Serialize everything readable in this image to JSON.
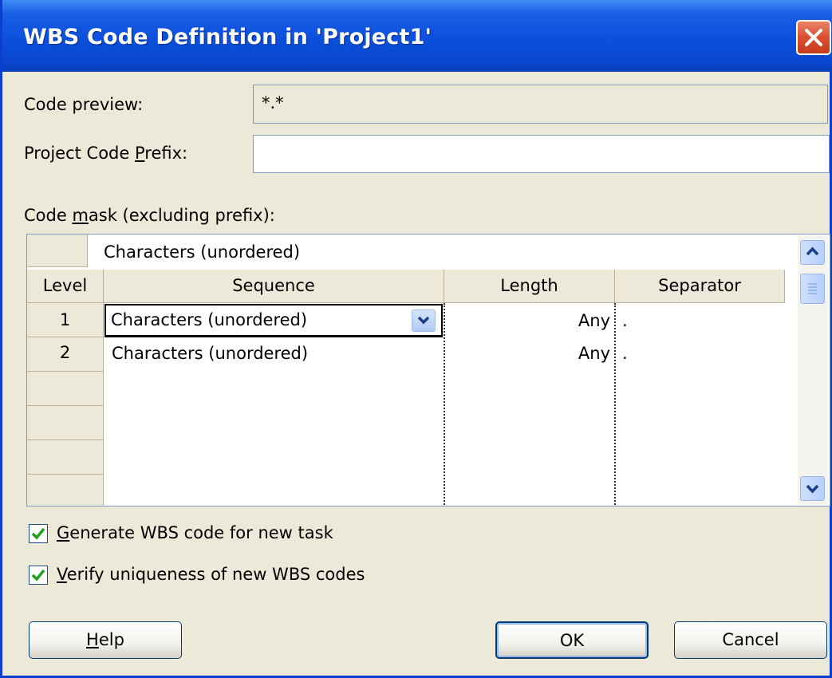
{
  "window": {
    "title": "WBS Code Definition in 'Project1'"
  },
  "code_preview": {
    "label": "Code preview:",
    "value": "*.*"
  },
  "project_prefix": {
    "label_pre": "Project Code ",
    "label_key": "P",
    "label_post": "refix:",
    "value": ""
  },
  "code_mask": {
    "label_pre": "Code ",
    "label_key": "m",
    "label_post": "ask (excluding prefix):"
  },
  "grid": {
    "edit_value": "Characters (unordered)",
    "columns": [
      "Level",
      "Sequence",
      "Length",
      "Separator"
    ],
    "rows": [
      {
        "level": "1",
        "sequence": "Characters (unordered)",
        "length": "Any",
        "separator": "."
      },
      {
        "level": "2",
        "sequence": "Characters (unordered)",
        "length": "Any",
        "separator": "."
      }
    ]
  },
  "options": {
    "generate": {
      "key": "G",
      "rest": "enerate WBS code for new task",
      "checked": true
    },
    "verify": {
      "key": "V",
      "rest": "erify uniqueness of new WBS codes",
      "checked": true
    }
  },
  "buttons": {
    "help_key": "H",
    "help_rest": "elp",
    "ok": "OK",
    "cancel": "Cancel"
  },
  "colors": {
    "title_blue": "#0b4fdb",
    "close_red": "#d9502f",
    "check_green": "#21a121",
    "face": "#ece9d8"
  }
}
